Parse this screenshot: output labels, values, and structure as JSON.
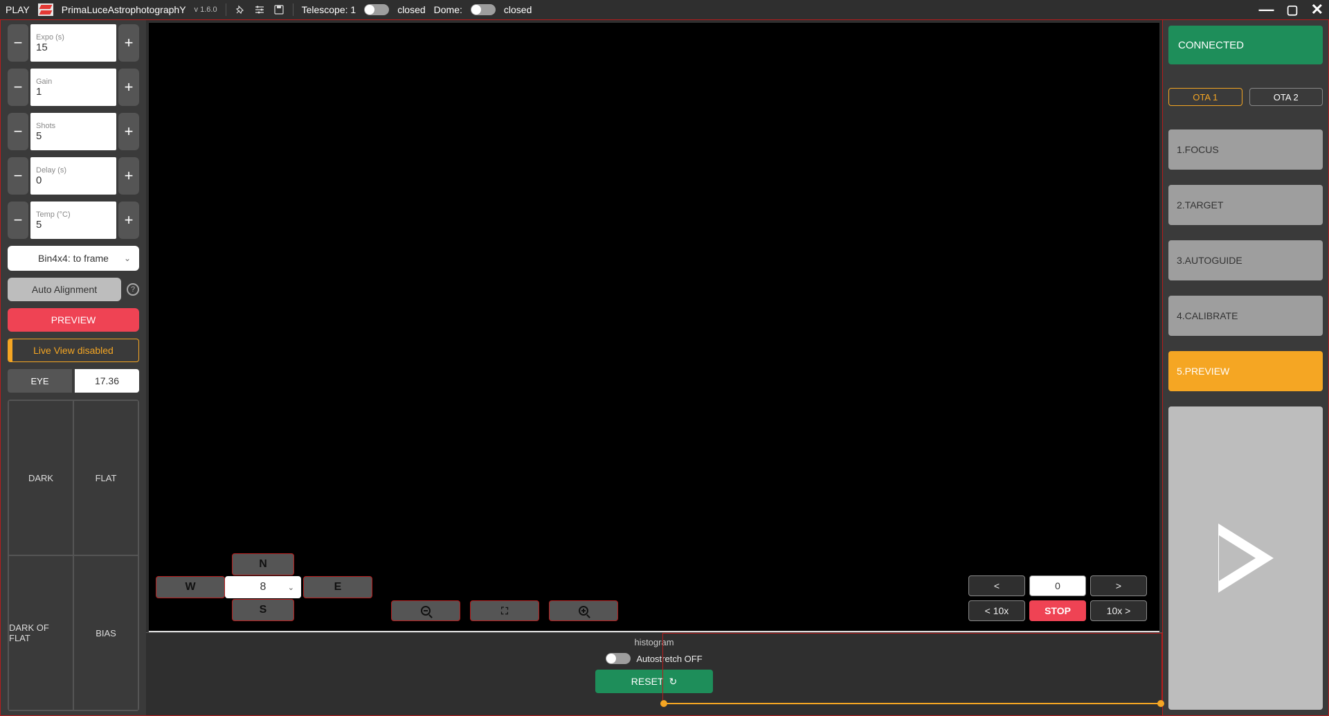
{
  "titlebar": {
    "brand_play": "PLAY",
    "brand_name": "PrimaLuceAstrophotographY",
    "version": "v 1.6.0",
    "telescope_label": "Telescope: 1",
    "telescope_state": "closed",
    "dome_label": "Dome:",
    "dome_state": "closed"
  },
  "inputs": {
    "expo": {
      "label": "Expo (s)",
      "value": "15"
    },
    "gain": {
      "label": "Gain",
      "value": "1"
    },
    "shots": {
      "label": "Shots",
      "value": "5"
    },
    "delay": {
      "label": "Delay (s)",
      "value": "0"
    },
    "temp": {
      "label": "Temp (°C)",
      "value": "5"
    }
  },
  "bin_select": "Bin4x4: to frame",
  "auto_align": "Auto Alignment",
  "preview_btn": "PREVIEW",
  "live_view": "Live View disabled",
  "eye": {
    "label": "EYE",
    "value": "17.36"
  },
  "frames": {
    "dark": "DARK",
    "flat": "FLAT",
    "dof": "DARK OF FLAT",
    "bias": "BIAS"
  },
  "dir": {
    "n": "N",
    "s": "S",
    "e": "E",
    "w": "W",
    "speed": "8"
  },
  "rot": {
    "left": "<",
    "right": ">",
    "val": "0",
    "l10": "< 10x",
    "r10": "10x >",
    "stop": "STOP"
  },
  "histo": {
    "title": "histogram",
    "autostretch": "Autostretch OFF",
    "reset": "RESET"
  },
  "right": {
    "connected": "CONNECTED",
    "ota1": "OTA 1",
    "ota2": "OTA 2",
    "s1": "1.FOCUS",
    "s2": "2.TARGET",
    "s3": "3.AUTOGUIDE",
    "s4": "4.CALIBRATE",
    "s5": "5.PREVIEW"
  }
}
